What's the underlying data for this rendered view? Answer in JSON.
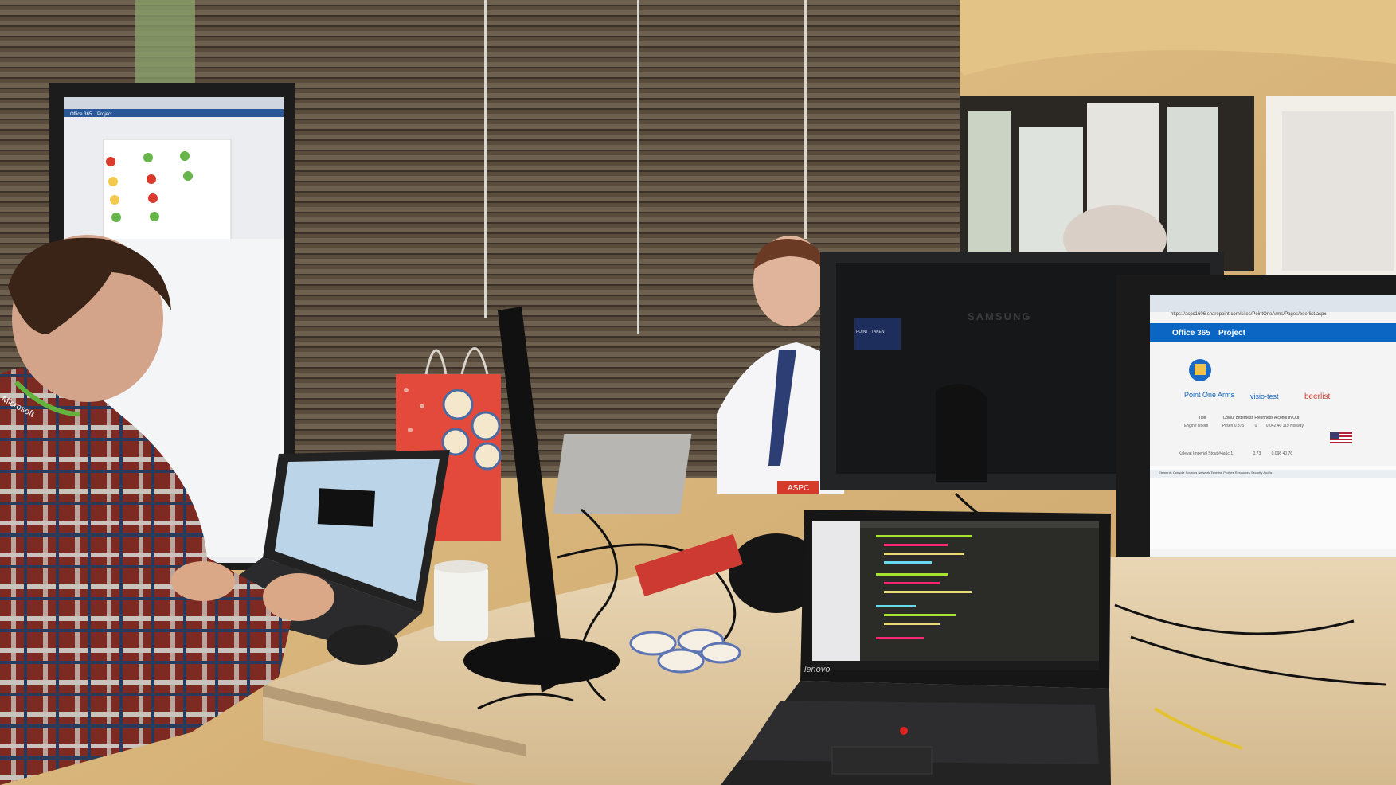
{
  "vertical_screen": {
    "header_labels": [
      "Office 365",
      "Project"
    ]
  },
  "right_monitor": {
    "url": "https://aspc1606.sharepoint.com/sites/PointOneArms/Pages/beerlist.aspx",
    "suite_bar": {
      "app": "Office 365",
      "section": "Project"
    },
    "site_nav": [
      "Point One Arms",
      "visio-test",
      "beerlist"
    ],
    "table_headers": [
      "Title",
      "Colour",
      "Bitterness",
      "Freshness",
      "Alcohol",
      "In",
      "Out"
    ],
    "rows": [
      {
        "title": "Engine Room",
        "colour": "Pilsen",
        "bitterness": "0.375",
        "freshness": "0",
        "alcohol": "0.042",
        "in": "40",
        "out": "119",
        "country": "Norway"
      },
      {
        "title": "Kalevat Imperial Stout #4a1c",
        "colour": "1",
        "bitterness": "",
        "freshness": "0.73",
        "alcohol": "0.098",
        "in": "40",
        "out": "76"
      }
    ],
    "devtools_tabs": [
      "Elements",
      "Console",
      "Sources",
      "Network",
      "Timeline",
      "Profiles",
      "Resources",
      "Security",
      "Audits"
    ]
  },
  "samsung_monitor": {
    "brand": "SAMSUNG",
    "sticker": "POINT | TAKEN"
  },
  "front_laptop": {
    "brand": "lenovo"
  },
  "badge": {
    "lanyard_text": "Microsoft",
    "tag": "ASPC"
  },
  "colors": {
    "wall_wood": "#d9b67a",
    "blinds": "#5b4e3e",
    "desk": "#e3cda8",
    "shirt_plaid_red": "#8a2c22",
    "o365_blue": "#0a66c2",
    "code_bg": "#272822"
  }
}
